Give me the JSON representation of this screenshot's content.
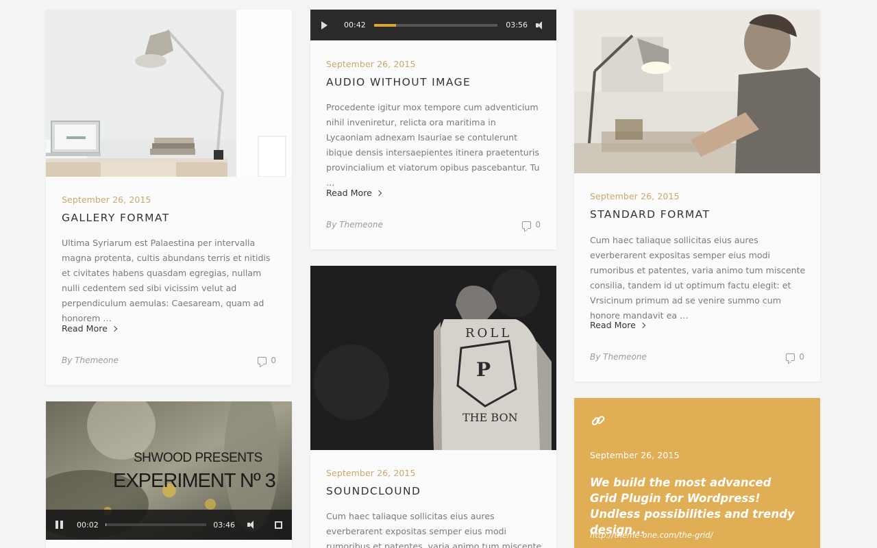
{
  "posts": {
    "gallery": {
      "date": "September 26, 2015",
      "title": "GALLERY FORMAT",
      "excerpt": "Ultima Syriarum est Palaestina per intervalla magna protenta, cultis abundans terris et nitidis et civitates habens quasdam egregias, nullam nulli cedentem sed sibi vicissim velut ad perpendiculum aemulas: Caesaream, quam ad honorem …",
      "read_more": "Read More",
      "author": "By Themeone",
      "comments": "0"
    },
    "audio": {
      "player": {
        "current": "00:42",
        "duration": "03:56",
        "progress": 0.18
      },
      "date": "September 26, 2015",
      "title": "AUDIO WITHOUT IMAGE",
      "excerpt": "Procedente igitur mox tempore cum adventicium nihil inveniretur, relicta ora maritima in Lycaoniam adnexam Isauriae se contulerunt ibique densis intersaepientes itinera praetenturis provincialium et viatorum opibus pascebantur. Tu …",
      "read_more": "Read More",
      "author": "By Themeone",
      "comments": "0"
    },
    "standard": {
      "date": "September 26, 2015",
      "title": "STANDARD FORMAT",
      "excerpt": "Cum haec taliaque sollicitas eius aures everberarent expositas semper eius modi rumoribus et patentes, varia animo tum miscente consilia, tandem id ut optimum factu elegit: et Vrsicinum primum ad se venire summo cum honore mandavit ea …",
      "read_more": "Read More",
      "author": "By Themeone",
      "comments": "0"
    },
    "soundcloud": {
      "image_text": [
        "ROLL",
        "P",
        "THE BON"
      ],
      "date": "September 26, 2015",
      "title": "SOUNDCLOUND",
      "excerpt": "Cum haec taliaque sollicitas eius aures everberarent expositas semper eius modi rumoribus et patentes, varia animo tum miscente consilia, tandem id ut"
    },
    "video": {
      "overlay_line1": "SHWOOD PRESENTS",
      "overlay_line2": "EXPERIMENT Nº 3",
      "current": "00:02",
      "duration": "03:46",
      "progress": 0.01
    },
    "link": {
      "date": "September 26, 2015",
      "quote": "We build the most advanced Grid Plugin for Wordpress! Undless possibilities and trendy design...",
      "url": "http://theme-one.com/the-grid/"
    }
  },
  "colors": {
    "accent": "#e0a52a",
    "date": "#c9a86a",
    "link_card": "#dfae55"
  }
}
